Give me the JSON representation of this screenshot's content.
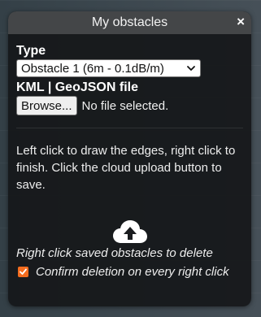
{
  "panel": {
    "title": "My obstacles",
    "close_label": "×"
  },
  "type_section": {
    "label": "Type",
    "selected": "Obstacle 1 (6m - 0.1dB/m)"
  },
  "file_section": {
    "label": "KML | GeoJSON file",
    "browse_label": "Browse...",
    "status": "No file selected."
  },
  "instructions": "Left click to draw the edges, right click to finish. Click the cloud upload button to save.",
  "upload": {
    "icon": "cloud-upload-icon"
  },
  "delete_hint": "Right click saved obstacles to delete",
  "confirm": {
    "label": "Confirm deletion on every right click",
    "checked": true,
    "color": "#f36c1f"
  }
}
